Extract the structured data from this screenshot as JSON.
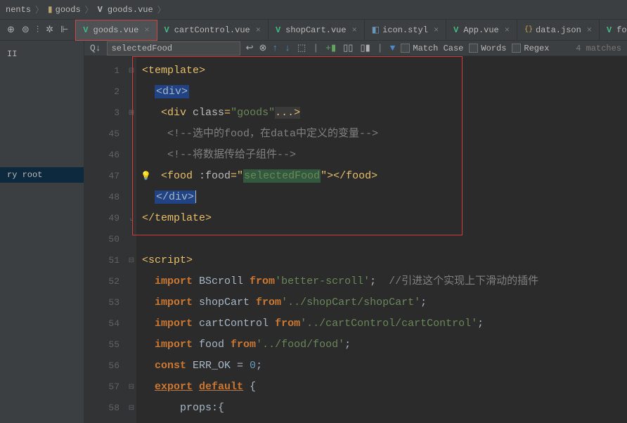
{
  "breadcrumb": {
    "item1": "nents",
    "item2": "goods",
    "item3": "goods.vue"
  },
  "tabs": [
    {
      "icon": "V",
      "label": "goods.vue"
    },
    {
      "icon": "V",
      "label": "cartControl.vue"
    },
    {
      "icon": "V",
      "label": "shopCart.vue"
    },
    {
      "icon": "styl",
      "label": "icon.styl"
    },
    {
      "icon": "V",
      "label": "App.vue"
    },
    {
      "icon": "json",
      "label": "data.json"
    },
    {
      "icon": "V",
      "label": "food.vue"
    }
  ],
  "sidebar": {
    "item1": "II",
    "item2": "ry root"
  },
  "search": {
    "value": "selectedFood",
    "match_case": "Match Case",
    "words": "Words",
    "regex": "Regex",
    "matches": "4 matches"
  },
  "lines": {
    "n1": "1",
    "n2": "2",
    "n3": "3",
    "n45": "45",
    "n46": "46",
    "n47": "47",
    "n48": "48",
    "n49": "49",
    "n50": "50",
    "n51": "51",
    "n52": "52",
    "n53": "53",
    "n54": "54",
    "n55": "55",
    "n56": "56",
    "n57": "57",
    "n58": "58"
  },
  "code": {
    "l1_open": "<template>",
    "l2_div": "<div>",
    "l3": "<div class=\"goods\"...>",
    "l3_a": "<div ",
    "l3_b": "class",
    "l3_c": "=",
    "l3_d": "\"goods\"",
    "l3_e": "...>",
    "l45": "<!--选中的food，在data中定义的变量-->",
    "l46": "<!--将数据传给子组件-->",
    "l47_a": "<food ",
    "l47_b": ":food",
    "l47_c": "=\"",
    "l47_d": "selectedFood",
    "l47_e": "\"></food>",
    "l48": "</div>",
    "l49": "</template>",
    "l51": "<script>",
    "l52_a": "import",
    "l52_b": " BScroll ",
    "l52_c": "from",
    "l52_d": "'better-scroll'",
    "l52_e": ";  ",
    "l52_f": "//引进这个实现上下滑动的插件",
    "l53_a": "import",
    "l53_b": " shopCart ",
    "l53_c": "from",
    "l53_d": "'../shopCart/shopCart'",
    "l53_e": ";",
    "l54_a": "import",
    "l54_b": " cartControl ",
    "l54_c": "from",
    "l54_d": "'../cartControl/cartControl'",
    "l54_e": ";",
    "l55_a": "import",
    "l55_b": " food ",
    "l55_c": "from",
    "l55_d": "'../food/food'",
    "l55_e": ";",
    "l56_a": "const",
    "l56_b": " ERR_OK = ",
    "l56_c": "0",
    "l56_d": ";",
    "l57_a": "export",
    "l57_b": " ",
    "l57_c": "default",
    "l57_d": " {",
    "l58": "props:{"
  }
}
